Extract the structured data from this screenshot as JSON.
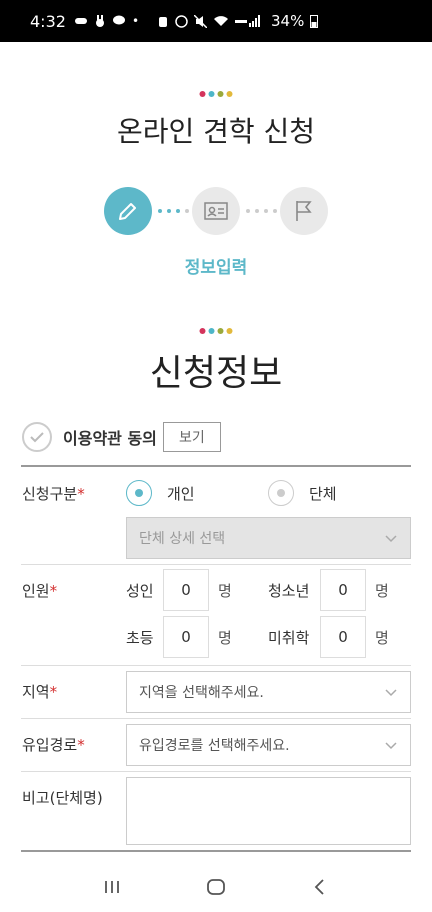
{
  "status_bar": {
    "time": "4:32",
    "battery": "34%"
  },
  "header": {
    "title": "온라인 견학 신청",
    "dot_colors": [
      "#d4345c",
      "#4db6c8",
      "#9aa93b",
      "#e2b93b"
    ]
  },
  "steps": {
    "current_label": "정보입력",
    "icons": [
      "pencil-icon",
      "id-card-icon",
      "flag-icon"
    ],
    "active_color": "#5db8c9"
  },
  "section": {
    "title": "신청정보"
  },
  "agreement": {
    "label": "이용약관 동의",
    "view_button": "보기"
  },
  "form": {
    "type": {
      "label": "신청구분",
      "required_mark": "*",
      "options": [
        "개인",
        "단체"
      ],
      "selected": "개인",
      "group_detail_placeholder": "단체 상세 선택"
    },
    "people": {
      "label": "인원",
      "required_mark": "*",
      "adult_label": "성인",
      "adult_value": "0",
      "youth_label": "청소년",
      "youth_value": "0",
      "elementary_label": "초등",
      "elementary_value": "0",
      "preschool_label": "미취학",
      "preschool_value": "0",
      "unit": "명"
    },
    "region": {
      "label": "지역",
      "required_mark": "*",
      "placeholder": "지역을 선택해주세요."
    },
    "referral": {
      "label": "유입경로",
      "required_mark": "*",
      "placeholder": "유입경로를 선택해주세요."
    },
    "note": {
      "label": "비고(단체명)"
    }
  },
  "navbar": {
    "icons": [
      "recent-apps-icon",
      "home-icon",
      "back-icon"
    ]
  }
}
